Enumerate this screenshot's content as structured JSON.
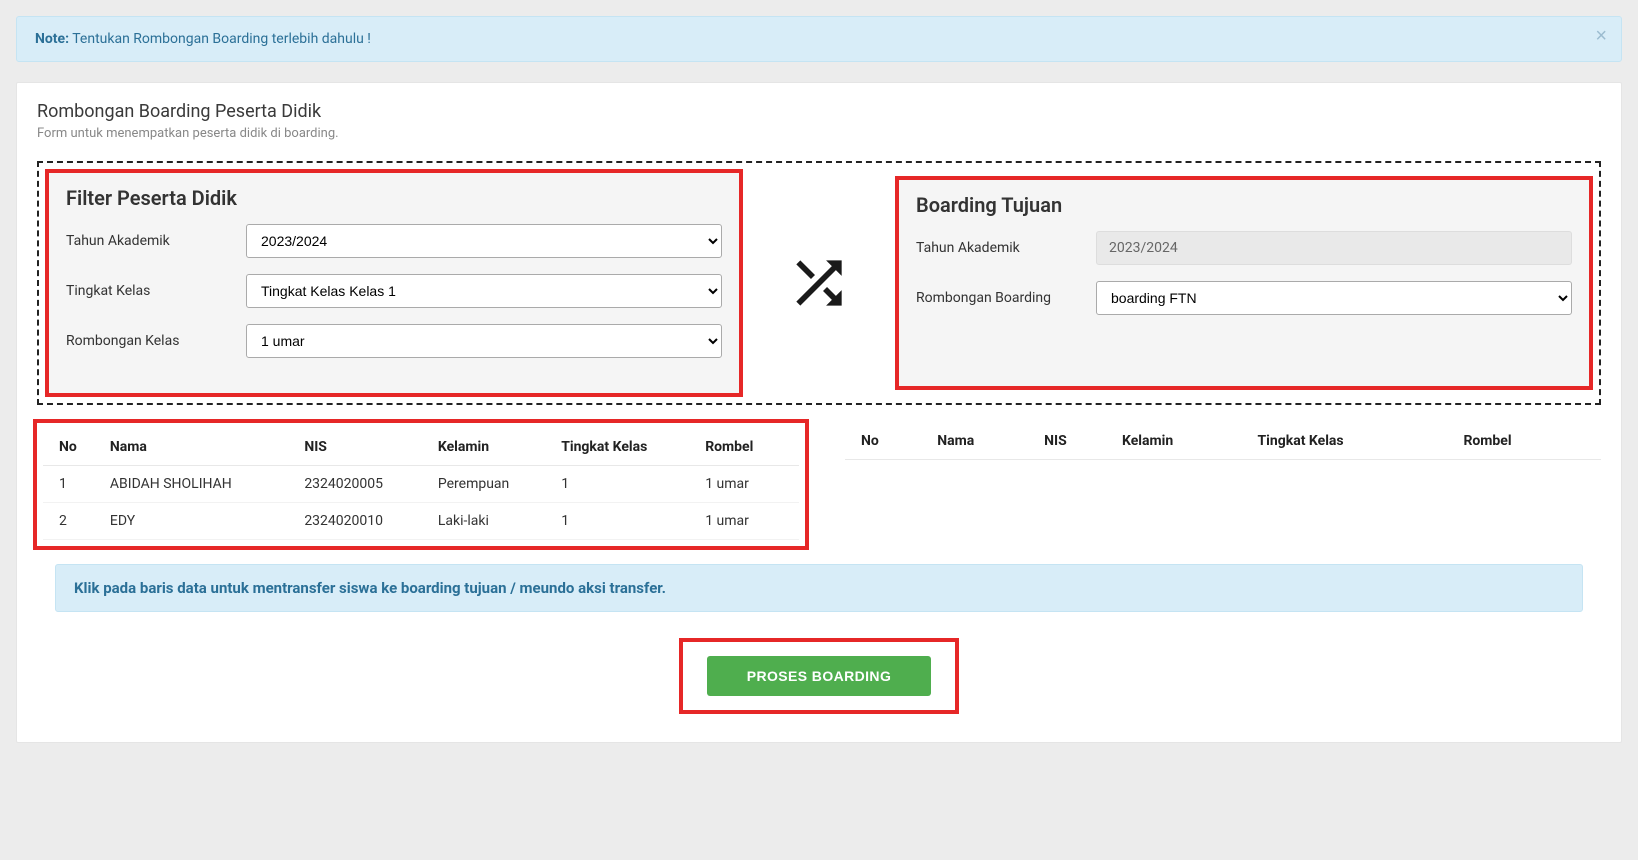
{
  "alert": {
    "note_label": "Note:",
    "text": " Tentukan Rombongan Boarding terlebih dahulu !",
    "close": "×"
  },
  "panel": {
    "title": "Rombongan Boarding Peserta Didik",
    "subtitle": "Form untuk menempatkan peserta didik di boarding."
  },
  "filter": {
    "title": "Filter Peserta Didik",
    "tahun_label": "Tahun Akademik",
    "tahun_value": "2023/2024",
    "tingkat_label": "Tingkat Kelas",
    "tingkat_value": "Tingkat Kelas Kelas 1",
    "rombel_label": "Rombongan Kelas",
    "rombel_value": "1 umar"
  },
  "tujuan": {
    "title": "Boarding Tujuan",
    "tahun_label": "Tahun Akademik",
    "tahun_value": "2023/2024",
    "rombel_label": "Rombongan Boarding",
    "rombel_value": "boarding FTN"
  },
  "table": {
    "headers": {
      "no": "No",
      "nama": "Nama",
      "nis": "NIS",
      "kelamin": "Kelamin",
      "tingkat": "Tingkat Kelas",
      "rombel": "Rombel"
    },
    "rows_left": [
      {
        "no": "1",
        "nama": "ABIDAH SHOLIHAH",
        "nis": "2324020005",
        "kelamin": "Perempuan",
        "tingkat": "1",
        "rombel": "1 umar"
      },
      {
        "no": "2",
        "nama": "EDY",
        "nis": "2324020010",
        "kelamin": "Laki-laki",
        "tingkat": "1",
        "rombel": "1 umar"
      }
    ],
    "rows_right": []
  },
  "instruction": "Klik pada baris data untuk mentransfer siswa ke boarding tujuan / meundo aksi transfer.",
  "button": {
    "process": "PROSES BOARDING"
  }
}
